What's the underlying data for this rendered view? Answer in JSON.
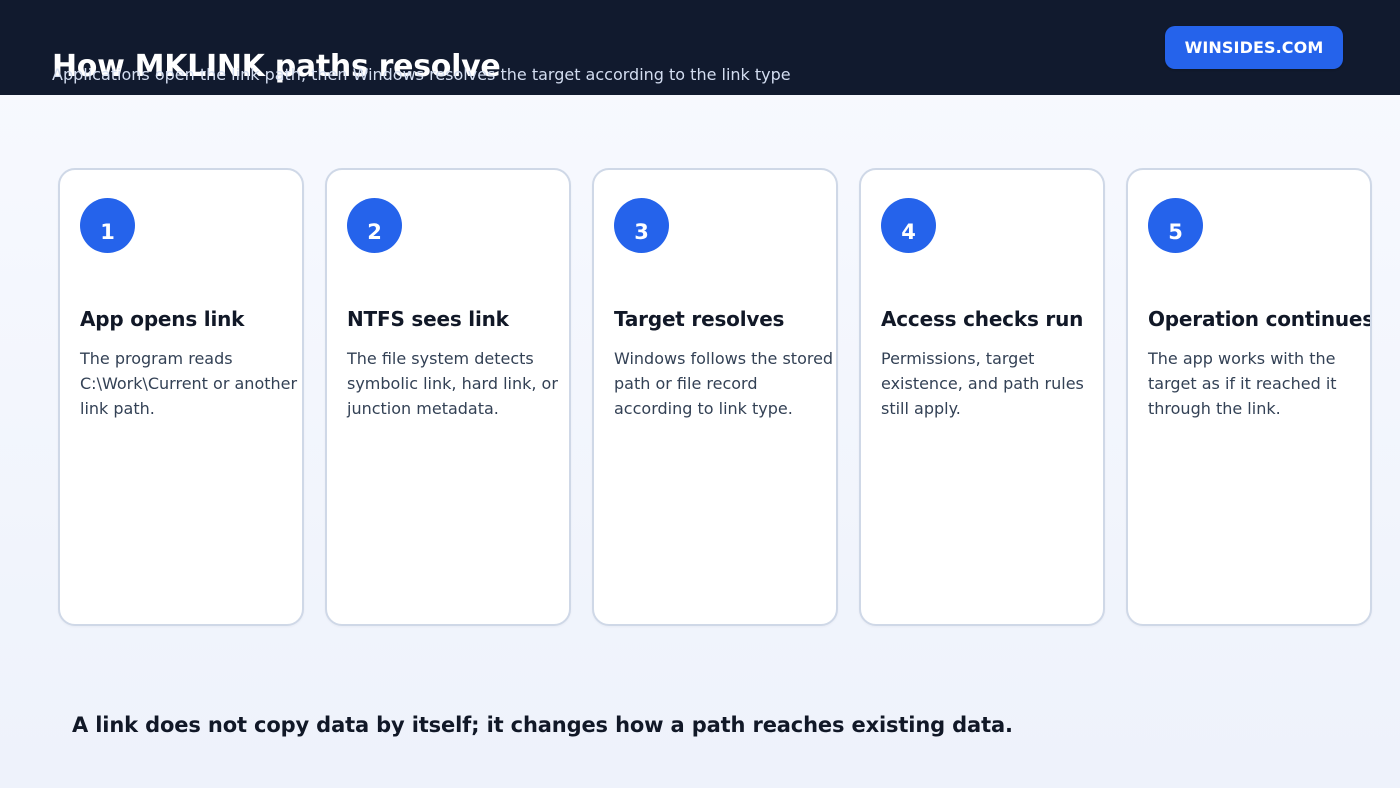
{
  "header": {
    "title": "How MKLINK paths resolve",
    "subtitle": "Applications open the link path, then Windows resolves the target according to the link type",
    "brand": "WINSIDES.COM"
  },
  "steps": [
    {
      "number": "1",
      "title": "App opens link",
      "body": "The program reads C:\\Work\\Current or another link path."
    },
    {
      "number": "2",
      "title": "NTFS sees link",
      "body": "The file system detects symbolic link, hard link, or junction metadata."
    },
    {
      "number": "3",
      "title": "Target resolves",
      "body": "Windows follows the stored path or file record according to link type."
    },
    {
      "number": "4",
      "title": "Access checks run",
      "body": "Permissions, target existence, and path rules still apply."
    },
    {
      "number": "5",
      "title": "Operation continues",
      "body": "The app works with the target as if it reached it through the link."
    }
  ],
  "footer": {
    "note": "A link does not copy data by itself; it changes how a path reaches existing data."
  },
  "colors": {
    "header_background": "#111a2e",
    "accent": "#2563eb",
    "card_border": "#cfd8e7",
    "text_primary": "#111827",
    "text_body": "#334155"
  }
}
